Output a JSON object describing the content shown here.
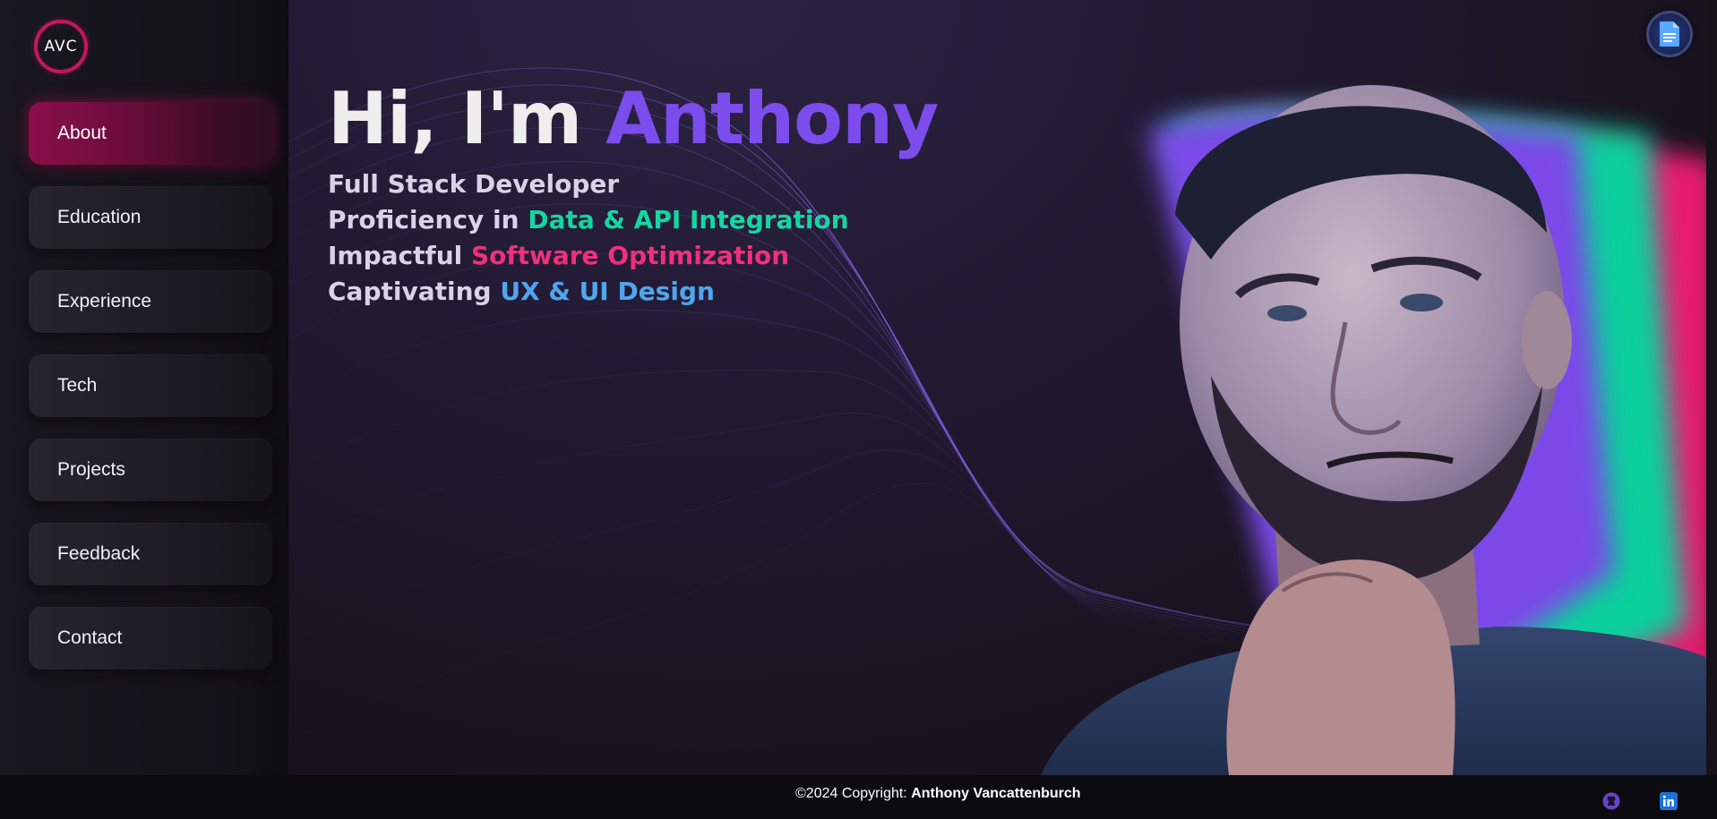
{
  "logo": {
    "text": "AVC"
  },
  "nav": {
    "items": [
      {
        "label": "About",
        "active": true
      },
      {
        "label": "Education"
      },
      {
        "label": "Experience"
      },
      {
        "label": "Tech"
      },
      {
        "label": "Projects"
      },
      {
        "label": "Feedback"
      },
      {
        "label": "Contact"
      }
    ]
  },
  "hero": {
    "greeting": "Hi, I'm ",
    "name": "Anthony",
    "lines": [
      {
        "prefix": "Full Stack Developer",
        "highlight": ""
      },
      {
        "prefix": "Proficiency in ",
        "highlight": "Data & API Integration"
      },
      {
        "prefix": "Impactful ",
        "highlight": "Software Optimization"
      },
      {
        "prefix": "Captivating ",
        "highlight": "UX & UI Design"
      }
    ]
  },
  "footer": {
    "copyright_prefix": "©2024 Copyright: ",
    "copyright_name": "Anthony Vancattenburch"
  },
  "icons": {
    "resume": "document-icon",
    "github": "github-icon",
    "linkedin": "linkedin-icon"
  },
  "colors": {
    "accent_purple": "#7c4dec",
    "accent_green": "#15d6a2",
    "accent_pink": "#f0307a",
    "accent_blue": "#4fa6ef",
    "active_nav": "#8a0f4a"
  }
}
